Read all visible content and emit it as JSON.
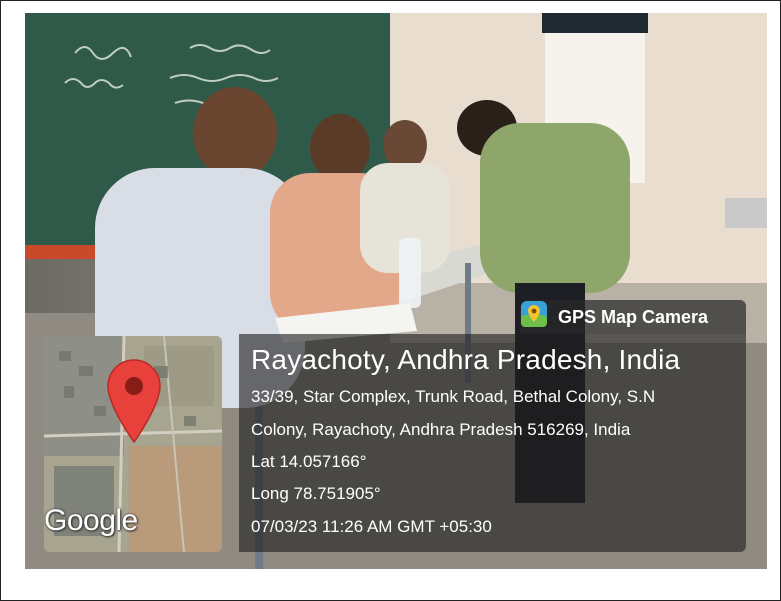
{
  "badge": {
    "app_name": "GPS Map Camera",
    "icon": "map-pin-icon"
  },
  "location": {
    "place": "Rayachoty, Andhra Pradesh, India",
    "address_line1": "33/39, Star Complex, Trunk Road, Bethal Colony, S.N",
    "address_line2": "Colony, Rayachoty, Andhra Pradesh 516269, India",
    "lat": "Lat 14.057166°",
    "long": "Long 78.751905°",
    "datetime": "07/03/23 11:26 AM GMT +05:30"
  },
  "map": {
    "provider_logo": "Google",
    "marker_icon": "location-marker-icon"
  },
  "colors": {
    "marker_red": "#e8403a",
    "panel_bg": "#1e1e1e"
  }
}
